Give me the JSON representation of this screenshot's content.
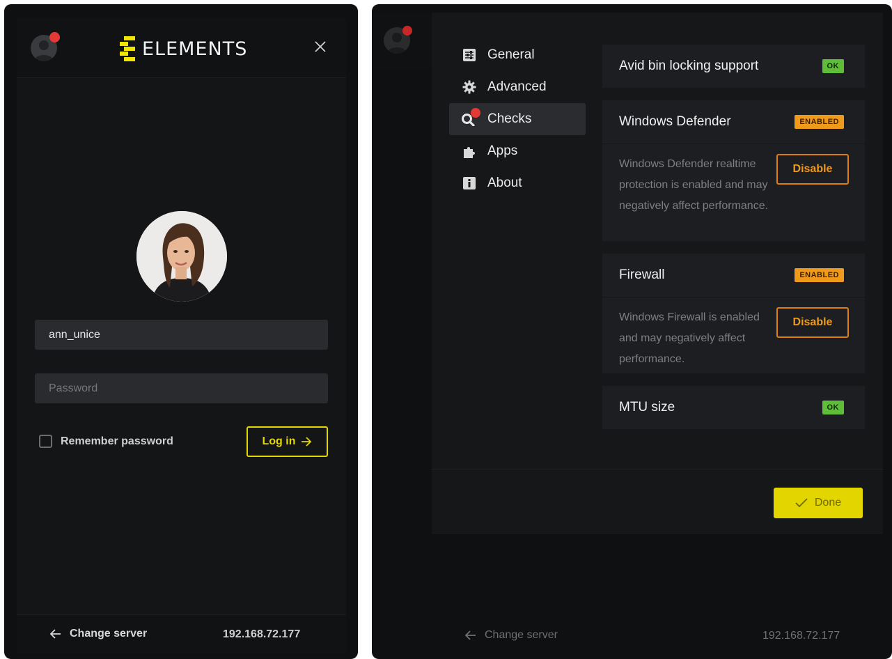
{
  "login": {
    "logo_text": "ELEMENTS",
    "username_value": "ann_unice",
    "password_placeholder": "Password",
    "remember_label": "Remember password",
    "login_label": "Log in",
    "change_server_label": "Change server",
    "server_ip": "192.168.72.177"
  },
  "settings": {
    "nav": [
      {
        "label": "General",
        "icon": "sliders-icon"
      },
      {
        "label": "Advanced",
        "icon": "gear-icon"
      },
      {
        "label": "Checks",
        "icon": "search-icon"
      },
      {
        "label": "Apps",
        "icon": "puzzle-icon"
      },
      {
        "label": "About",
        "icon": "info-icon"
      }
    ],
    "active_nav": "Checks",
    "checks": [
      {
        "title": "Avid bin locking support",
        "status": "OK"
      },
      {
        "title": "Windows Defender",
        "status": "ENABLED",
        "description": "Windows Defender realtime protection is enabled and may negatively affect performance.",
        "action": "Disable"
      },
      {
        "title": "Firewall",
        "status": "ENABLED",
        "description": "Windows Firewall is enabled and may negatively affect performance.",
        "action": "Disable"
      },
      {
        "title": "MTU size",
        "status": "OK"
      }
    ],
    "done_label": "Done",
    "change_server_label": "Change server",
    "server_ip": "192.168.72.177"
  },
  "colors": {
    "accent_yellow": "#e3d800",
    "ok_green": "#5fbd3a",
    "warning_orange": "#ef9a1a",
    "notification_red": "#e53935"
  }
}
